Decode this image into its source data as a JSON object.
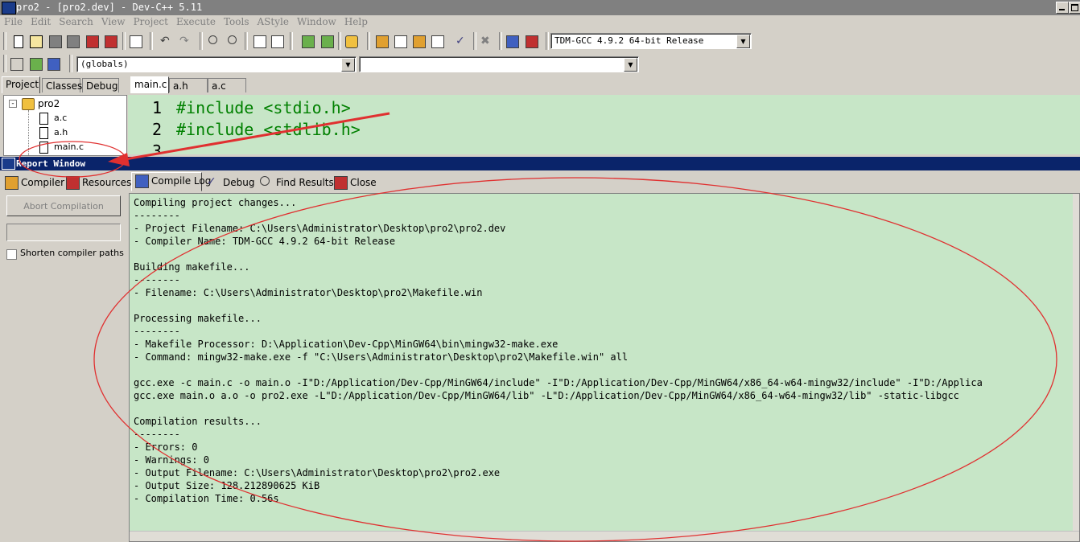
{
  "window": {
    "title": "pro2 - [pro2.dev] - Dev-C++ 5.11"
  },
  "menu": [
    "File",
    "Edit",
    "Search",
    "View",
    "Project",
    "Execute",
    "Tools",
    "AStyle",
    "Window",
    "Help"
  ],
  "toolbar": {
    "compiler_select": "TDM-GCC 4.9.2 64-bit Release",
    "scope_select": "(globals)",
    "member_select": ""
  },
  "side_tabs": [
    "Project",
    "Classes",
    "Debug"
  ],
  "editor_tabs": [
    "main.c",
    "a.h",
    "a.c"
  ],
  "project_tree": {
    "root": "pro2",
    "files": [
      "a.c",
      "a.h",
      "main.c"
    ]
  },
  "editor": {
    "lines": [
      {
        "num": "1",
        "text": "#include <stdio.h>"
      },
      {
        "num": "2",
        "text": "#include <stdlib.h>"
      },
      {
        "num": "3",
        "text": ""
      }
    ]
  },
  "report": {
    "title": "Report Window",
    "tabs": [
      "Compiler",
      "Resources",
      "Compile Log",
      "Debug",
      "Find Results",
      "Close"
    ],
    "active_tab": "Compile Log",
    "abort_button": "Abort Compilation",
    "shorten_paths_label": "Shorten compiler paths",
    "log": [
      "Compiling project changes...",
      "--------",
      "- Project Filename: C:\\Users\\Administrator\\Desktop\\pro2\\pro2.dev",
      "- Compiler Name: TDM-GCC 4.9.2 64-bit Release",
      "",
      "Building makefile...",
      "--------",
      "- Filename: C:\\Users\\Administrator\\Desktop\\pro2\\Makefile.win",
      "",
      "Processing makefile...",
      "--------",
      "- Makefile Processor: D:\\Application\\Dev-Cpp\\MinGW64\\bin\\mingw32-make.exe",
      "- Command: mingw32-make.exe -f \"C:\\Users\\Administrator\\Desktop\\pro2\\Makefile.win\" all",
      "",
      "gcc.exe -c main.c -o main.o -I\"D:/Application/Dev-Cpp/MinGW64/include\" -I\"D:/Application/Dev-Cpp/MinGW64/x86_64-w64-mingw32/include\" -I\"D:/Applica",
      "gcc.exe main.o a.o -o pro2.exe -L\"D:/Application/Dev-Cpp/MinGW64/lib\" -L\"D:/Application/Dev-Cpp/MinGW64/x86_64-w64-mingw32/lib\" -static-libgcc",
      "",
      "Compilation results...",
      "--------",
      "- Errors: 0",
      "- Warnings: 0",
      "- Output Filename: C:\\Users\\Administrator\\Desktop\\pro2\\pro2.exe",
      "- Output Size: 128.212890625 KiB",
      "- Compilation Time: 0.56s"
    ]
  },
  "colors": {
    "editor_bg": "#c7e6c7",
    "code_green": "#008000",
    "annotation_red": "#e03030",
    "report_bar": "#0a246a"
  }
}
